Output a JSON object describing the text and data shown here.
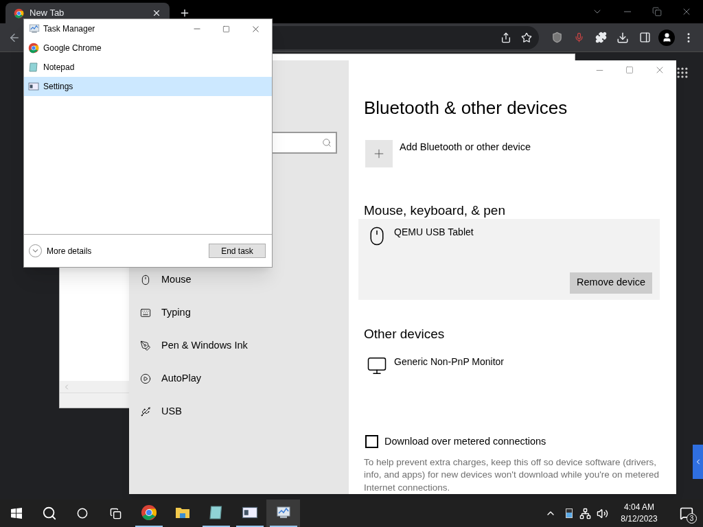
{
  "browser": {
    "tabs": [
      {
        "title": "New Tab",
        "selected": true
      }
    ]
  },
  "task_manager": {
    "title": "Task Manager",
    "apps": [
      {
        "name": "Google Chrome",
        "kind": "chrome",
        "selected": false
      },
      {
        "name": "Notepad",
        "kind": "notepad",
        "selected": false
      },
      {
        "name": "Settings",
        "kind": "settings",
        "selected": true
      }
    ],
    "more_details": "More details",
    "end_task": "End task"
  },
  "settings": {
    "nav": [
      {
        "label": "Mouse",
        "kind": "mouse"
      },
      {
        "label": "Typing",
        "kind": "keyboard"
      },
      {
        "label": "Pen & Windows Ink",
        "kind": "pen"
      },
      {
        "label": "AutoPlay",
        "kind": "autoplay"
      },
      {
        "label": "USB",
        "kind": "usb"
      }
    ],
    "heading": "Bluetooth & other devices",
    "add_device": "Add Bluetooth or other device",
    "sections": [
      {
        "heading": "Mouse, keyboard, & pen",
        "devices": [
          {
            "name": "QEMU USB Tablet",
            "kind": "mouse",
            "selected": true,
            "action": "Remove device"
          }
        ]
      },
      {
        "heading": "Other devices",
        "devices": [
          {
            "name": "Generic Non-PnP Monitor",
            "kind": "monitor",
            "selected": false
          }
        ]
      }
    ],
    "metered": {
      "label": "Download over metered connections",
      "checked": false,
      "description": "To help prevent extra charges, keep this off so device software (drivers, info, and apps) for new devices won't download while you're on metered Internet connections."
    }
  },
  "taskbar": {
    "apps": [
      {
        "kind": "chrome",
        "running": true,
        "active": false
      },
      {
        "kind": "explorer",
        "running": false,
        "active": false
      },
      {
        "kind": "notepad",
        "running": true,
        "active": false
      },
      {
        "kind": "settings",
        "running": true,
        "active": false
      },
      {
        "kind": "taskmanager",
        "running": true,
        "active": true
      }
    ],
    "time": "4:04 AM",
    "date": "8/12/2023",
    "notifications": "3"
  }
}
